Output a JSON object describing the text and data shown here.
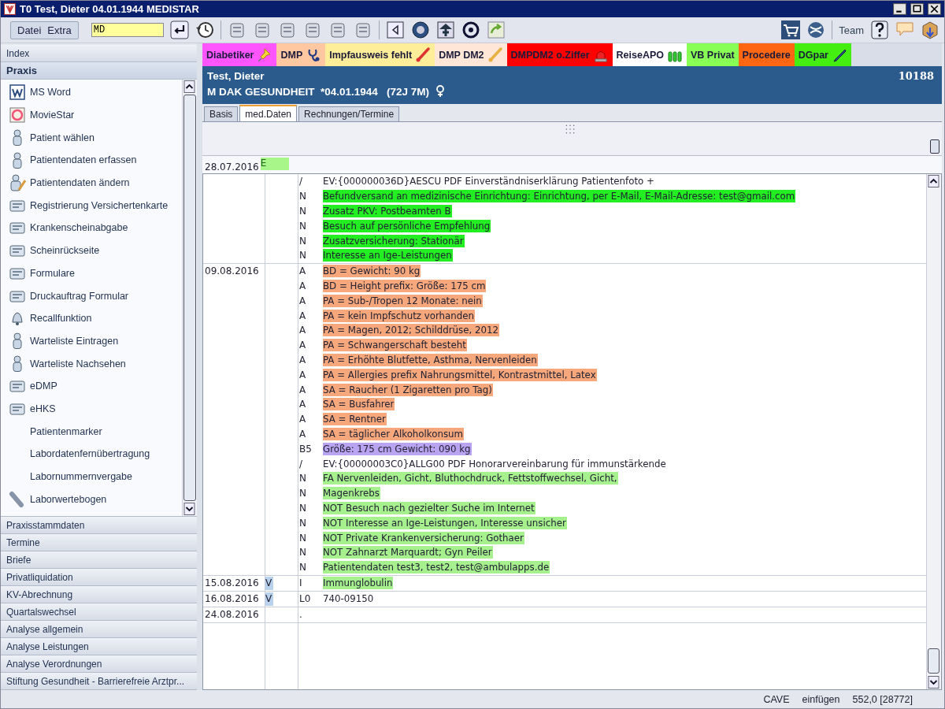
{
  "window": {
    "title": "T0 Test, Dieter 04.01.1944 MEDISTAR"
  },
  "toolbar": {
    "menus": [
      "Datei",
      "Extra"
    ],
    "command_field": {
      "value": "MD"
    },
    "team_label": "Team"
  },
  "sidebar": {
    "sections": [
      {
        "label": "Index",
        "selected": false
      },
      {
        "label": "Praxis",
        "selected": true,
        "items": [
          {
            "label": "MS Word",
            "icon": true
          },
          {
            "label": "MovieStar",
            "icon": true
          },
          {
            "label": "Patient wählen",
            "icon": true
          },
          {
            "label": "Patientendaten erfassen",
            "icon": true
          },
          {
            "label": "Patientendaten ändern",
            "icon": true
          },
          {
            "label": "Registrierung Versichertenkarte",
            "icon": true
          },
          {
            "label": "Krankenscheinabgabe",
            "icon": true
          },
          {
            "label": "Scheinrückseite",
            "icon": true
          },
          {
            "label": "Formulare",
            "icon": true
          },
          {
            "label": "Druckauftrag Formular",
            "icon": true
          },
          {
            "label": "Recallfunktion",
            "icon": true
          },
          {
            "label": "Warteliste Eintragen",
            "icon": true
          },
          {
            "label": "Warteliste Nachsehen",
            "icon": true
          },
          {
            "label": "eDMP",
            "icon": true
          },
          {
            "label": "eHKS",
            "icon": true
          },
          {
            "label": "Patientenmarker",
            "icon": false
          },
          {
            "label": "Labordatenfernübertragung",
            "icon": false
          },
          {
            "label": "Labornummernvergabe",
            "icon": false
          },
          {
            "label": "Laborwertebogen",
            "icon": true
          }
        ]
      },
      {
        "label": "Praxisstammdaten",
        "selected": false
      },
      {
        "label": "Termine",
        "selected": false
      },
      {
        "label": "Briefe",
        "selected": false
      },
      {
        "label": "Privatliquidation",
        "selected": false
      },
      {
        "label": "KV-Abrechnung",
        "selected": false
      },
      {
        "label": "Quartalswechsel",
        "selected": false
      },
      {
        "label": "Analyse allgemein",
        "selected": false
      },
      {
        "label": "Analyse Leistungen",
        "selected": false
      },
      {
        "label": "Analyse Verordnungen",
        "selected": false
      },
      {
        "label": "Stiftung Gesundheit - Barrierefreie Arztpr...",
        "selected": false
      }
    ]
  },
  "tags": [
    {
      "label": "Diabetiker",
      "color": "#ff55ff",
      "icon": true
    },
    {
      "label": "DMP",
      "color": "#ffc8a0",
      "icon": true
    },
    {
      "label": "Impfausweis fehlt",
      "color": "#ffee99",
      "icon": true
    },
    {
      "label": "DMP DM2",
      "color": "#ffe6d6",
      "icon": true
    },
    {
      "label": "DMPDM2 o.Ziffer",
      "color": "#ff0000",
      "icon": true
    },
    {
      "label": "ReiseAPO",
      "color": "#ffffff",
      "icon": true
    },
    {
      "label": "VB Privat",
      "color": "#88ff55",
      "icon": false
    },
    {
      "label": "Procedere",
      "color": "#ff6611",
      "icon": false
    },
    {
      "label": "DGpar",
      "color": "#44ee11",
      "icon": true
    }
  ],
  "patient": {
    "name": "Test, Dieter",
    "details": "M DAK GESUNDHEIT  *04.01.1944   (72J 7M)",
    "number": "10188"
  },
  "tabs": [
    {
      "label": "Basis",
      "selected": false
    },
    {
      "label": "med.Daten",
      "selected": true
    },
    {
      "label": "Rechnungen/Termine",
      "selected": false
    }
  ],
  "entries": {
    "first_date": {
      "date": "28.07.2016",
      "marker": "E",
      "color": "#a8f58a"
    },
    "groups": [
      {
        "lines": [
          {
            "code": "/",
            "text": "EV:{000000036D}AESCU PDF  Einverständniserklärung Patientenfoto +"
          },
          {
            "code": "N",
            "text": "Befundversand an medizinische Einrichtung: Einrichtung, per E-Mail, E-Mail-Adresse: test@gmail.com",
            "color": "#22ee22"
          },
          {
            "code": "N",
            "text": "Zusatz PKV: Postbeamten B",
            "color": "#22ee22"
          },
          {
            "code": "N",
            "text": "Besuch auf persönliche Empfehlung",
            "color": "#22ee22"
          },
          {
            "code": "N",
            "text": "Zusatzversicherung: Stationär",
            "color": "#22ee22"
          },
          {
            "code": "N",
            "text": "Interesse an Ige-Leistungen",
            "color": "#22ee22"
          }
        ]
      },
      {
        "date": "09.08.2016",
        "lines": [
          {
            "code": "A",
            "text": "BD = Gewicht: 90 kg",
            "color": "#f7a77c"
          },
          {
            "code": "A",
            "text": "BD = Height prefix: Größe: 175 cm",
            "color": "#f7a77c"
          },
          {
            "code": "A",
            "text": "PA = Sub-/Tropen 12 Monate: nein",
            "color": "#f7a77c"
          },
          {
            "code": "A",
            "text": "PA = kein Impfschutz vorhanden",
            "color": "#f7a77c"
          },
          {
            "code": "A",
            "text": "PA = Magen, 2012; Schilddrüse, 2012",
            "color": "#f7a77c"
          },
          {
            "code": "A",
            "text": "PA = Schwangerschaft besteht",
            "color": "#f7a77c"
          },
          {
            "code": "A",
            "text": "PA = Erhöhte Blutfette, Asthma, Nervenleiden",
            "color": "#f7a77c"
          },
          {
            "code": "A",
            "text": "PA = Allergies prefix Nahrungsmittel, Kontrastmittel, Latex",
            "color": "#f7a77c"
          },
          {
            "code": "A",
            "text": "SA = Raucher (1 Zigaretten pro Tag)",
            "color": "#f7a77c"
          },
          {
            "code": "A",
            "text": "SA = Busfahrer",
            "color": "#f7a77c"
          },
          {
            "code": "A",
            "text": "SA = Rentner",
            "color": "#f7a77c"
          },
          {
            "code": "A",
            "text": "SA = täglicher Alkoholkonsum",
            "color": "#f7a77c"
          },
          {
            "code": "B5",
            "text": "Größe: 175 cm  Gewicht: 090 kg",
            "color": "#b9a4f2"
          },
          {
            "code": "/",
            "text": "EV:{00000003C0}ALLG00 PDF  Honorarvereinbarung für immunstärkende"
          },
          {
            "code": "N",
            "text": "FA Nervenleiden, Gicht, Bluthochdruck, Fettstoffwechsel, Gicht,",
            "color": "#a6f08e"
          },
          {
            "code": "N",
            "text": "Magenkrebs",
            "color": "#a6f08e"
          },
          {
            "code": "N",
            "text": "NOT Besuch nach gezielter Suche im Internet",
            "color": "#a6f08e"
          },
          {
            "code": "N",
            "text": "NOT Interesse an Ige-Leistungen, Interesse unsicher",
            "color": "#a6f08e"
          },
          {
            "code": "N",
            "text": "NOT Private Krankenversicherung: Gothaer",
            "color": "#a6f08e"
          },
          {
            "code": "N",
            "text": "NOT Zahnarzt Marquardt; Gyn Peiler",
            "color": "#a6f08e"
          },
          {
            "code": "N",
            "text": "Patientendaten test3, test2, test@ambulapps.de",
            "color": "#a6f08e"
          }
        ]
      },
      {
        "date": "15.08.2016",
        "marker": "V",
        "color": "#b8d2ee",
        "lines": [
          {
            "code": "I",
            "text": "Immunglobulin",
            "color": "#a6f08e"
          }
        ]
      },
      {
        "date": "16.08.2016",
        "marker": "V",
        "color": "#b8d2ee",
        "lines": [
          {
            "code": "L0",
            "text": "740-09150"
          }
        ]
      },
      {
        "date": "24.08.2016",
        "lines": [
          {
            "code": "."
          }
        ]
      }
    ]
  },
  "status_bar": {
    "items": [
      "CAVE",
      "einfügen",
      "552,0 [28772]"
    ]
  }
}
